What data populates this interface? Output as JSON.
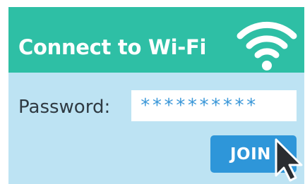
{
  "dialog": {
    "title": "Connect to Wi-Fi",
    "icon": "wifi-icon",
    "password_label": "Password:",
    "password_value": "**********",
    "join_label": "JOIN"
  },
  "colors": {
    "header": "#2ebfa5",
    "body": "#bde3f3",
    "button": "#2e96d9",
    "password_text": "#3a97d8",
    "label_text": "#2f3a42"
  },
  "cursor": "pointer-arrow-icon"
}
